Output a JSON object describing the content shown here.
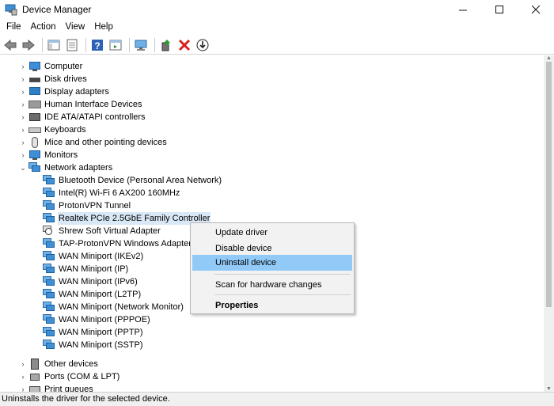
{
  "window": {
    "title": "Device Manager",
    "controls": {
      "minimize": "—",
      "maximize": "☐",
      "close": "✕"
    }
  },
  "menu": [
    "File",
    "Action",
    "View",
    "Help"
  ],
  "toolbar": [
    {
      "icon": "back-arrow-icon"
    },
    {
      "icon": "forward-arrow-icon"
    },
    {
      "icon": "show-hide-console-tree-icon"
    },
    {
      "icon": "properties-icon"
    },
    {
      "icon": "help-icon"
    },
    {
      "icon": "action-pane-icon"
    },
    {
      "icon": "scan-hardware-icon"
    },
    {
      "icon": "update-driver-icon"
    },
    {
      "icon": "uninstall-device-icon"
    },
    {
      "icon": "download-icon"
    }
  ],
  "tree": {
    "categories": [
      {
        "label": "Computer",
        "icon": "computer-icon",
        "expanded": false
      },
      {
        "label": "Disk drives",
        "icon": "disk-drive-icon",
        "expanded": false
      },
      {
        "label": "Display adapters",
        "icon": "display-adapter-icon",
        "expanded": false
      },
      {
        "label": "Human Interface Devices",
        "icon": "hid-icon",
        "expanded": false
      },
      {
        "label": "IDE ATA/ATAPI controllers",
        "icon": "ide-controller-icon",
        "expanded": false
      },
      {
        "label": "Keyboards",
        "icon": "keyboard-icon",
        "expanded": false
      },
      {
        "label": "Mice and other pointing devices",
        "icon": "mouse-icon",
        "expanded": false
      },
      {
        "label": "Monitors",
        "icon": "monitor-icon",
        "expanded": false
      },
      {
        "label": "Network adapters",
        "icon": "network-adapter-icon",
        "expanded": true
      }
    ],
    "network_adapters": [
      "Bluetooth Device (Personal Area Network)",
      "Intel(R) Wi-Fi 6 AX200 160MHz",
      "ProtonVPN Tunnel",
      "Realtek PCIe 2.5GbE Family Controller",
      "Shrew Soft Virtual Adapter",
      "TAP-ProtonVPN Windows Adapter V9",
      "WAN Miniport (IKEv2)",
      "WAN Miniport (IP)",
      "WAN Miniport (IPv6)",
      "WAN Miniport (L2TP)",
      "WAN Miniport (Network Monitor)",
      "WAN Miniport (PPPOE)",
      "WAN Miniport (PPTP)",
      "WAN Miniport (SSTP)"
    ],
    "selected": "Realtek PCIe 2.5GbE Family Controller",
    "after": [
      {
        "label": "Other devices",
        "icon": "other-devices-icon",
        "expanded": false
      },
      {
        "label": "Ports (COM & LPT)",
        "icon": "ports-icon",
        "expanded": false
      },
      {
        "label": "Print queues",
        "icon": "print-queue-icon",
        "expanded": false
      }
    ]
  },
  "context_menu": {
    "items": [
      {
        "label": "Update driver",
        "highlighted": false,
        "bold": false
      },
      {
        "label": "Disable device",
        "highlighted": false,
        "bold": false
      },
      {
        "label": "Uninstall device",
        "highlighted": true,
        "bold": false
      },
      {
        "label": "Scan for hardware changes",
        "highlighted": false,
        "bold": false
      },
      {
        "label": "Properties",
        "highlighted": false,
        "bold": true
      }
    ]
  },
  "status": "Uninstalls the driver for the selected device.",
  "colors": {
    "selection": "#d9e8f6",
    "menu_highlight": "#91c9f7",
    "statusbar": "#f0f0f0"
  }
}
